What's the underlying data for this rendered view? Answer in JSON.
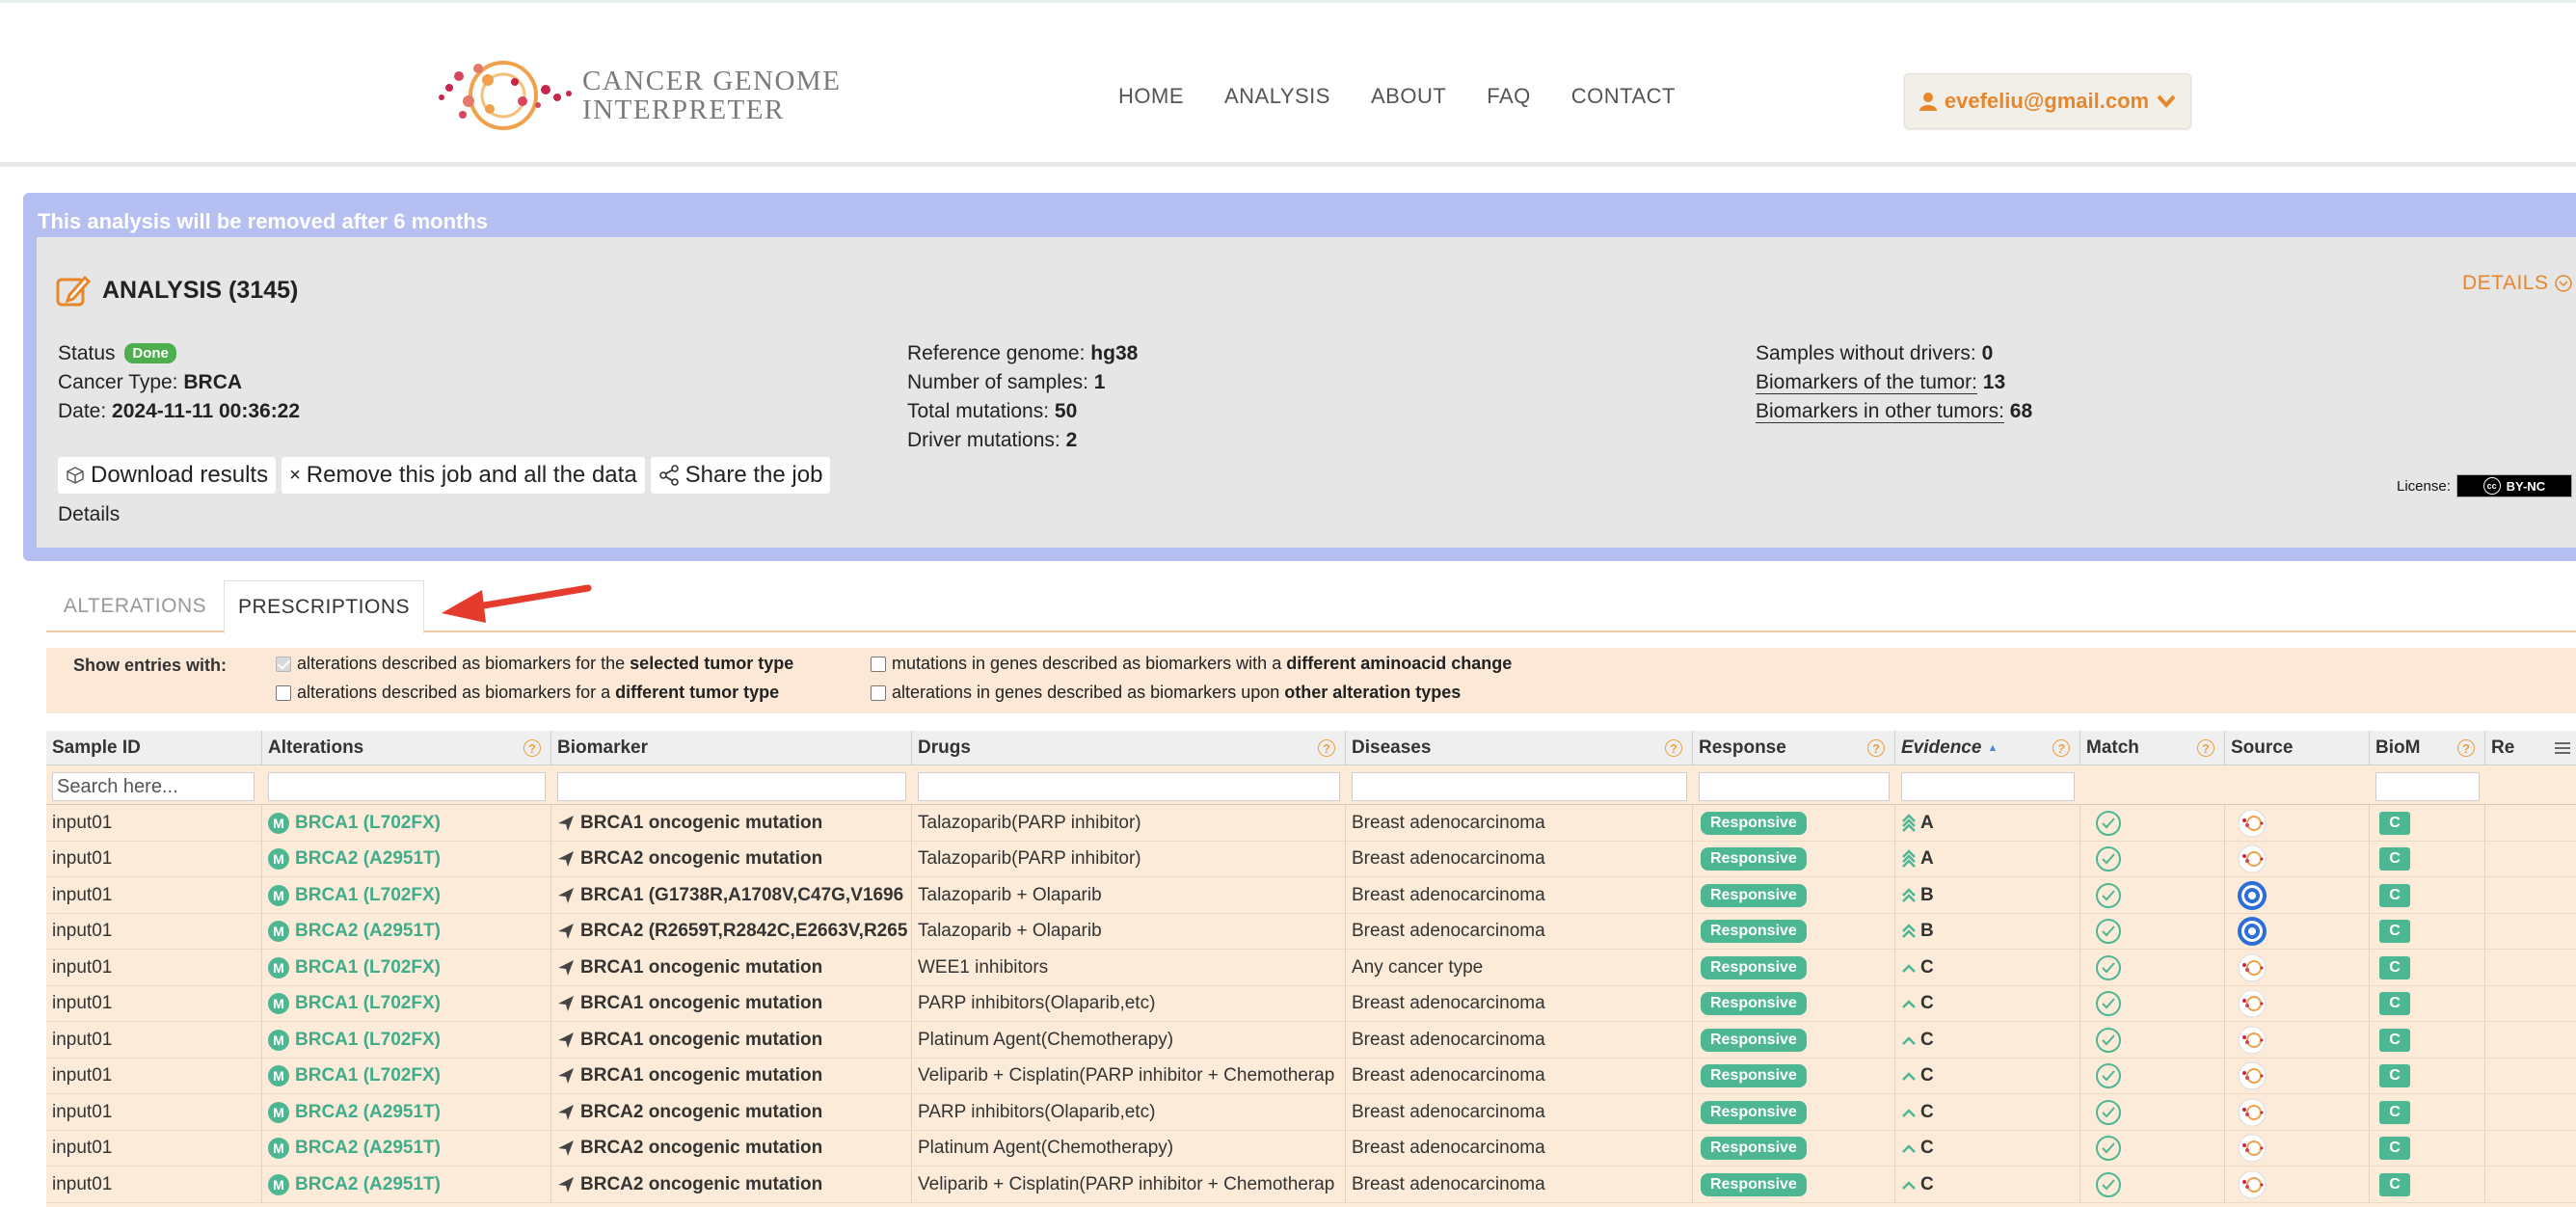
{
  "nav": {
    "logo_line1": "CANCER GENOME",
    "logo_line2": "INTERPRETER",
    "links": [
      "HOME",
      "ANALYSIS",
      "ABOUT",
      "FAQ",
      "CONTACT"
    ],
    "user_email": "evefeliu@gmail.com"
  },
  "colors": {
    "accent": "#e8862b",
    "green": "#4db794",
    "panel_border": "#b6bff1",
    "row_bg": "#fcebd8"
  },
  "analysis": {
    "removal_notice": "This analysis will be removed after 6 months",
    "title": "ANALYSIS (3145)",
    "details_link": "DETAILS",
    "status_label": "Status",
    "status_value": "Done",
    "cancer_type_label": "Cancer Type:",
    "cancer_type_value": "BRCA",
    "date_label": "Date:",
    "date_value": "2024-11-11 00:36:22",
    "ref_genome_label": "Reference genome:",
    "ref_genome_value": "hg38",
    "num_samples_label": "Number of samples:",
    "num_samples_value": "1",
    "total_mutations_label": "Total mutations:",
    "total_mutations_value": "50",
    "driver_mutations_label": "Driver mutations:",
    "driver_mutations_value": "2",
    "samples_without_drivers_label": "Samples without drivers:",
    "samples_without_drivers_value": "0",
    "biomarkers_tumor_label": "Biomarkers of the tumor:",
    "biomarkers_tumor_value": "13",
    "biomarkers_other_label": "Biomarkers in other tumors:",
    "biomarkers_other_value": "68",
    "download_label": "Download results",
    "remove_label": "Remove this job and all the data",
    "share_label": "Share the job",
    "details_text": "Details",
    "license_label": "License:",
    "license_badge": "BY-NC"
  },
  "tabs": [
    "ALTERATIONS",
    "PRESCRIPTIONS"
  ],
  "filters": {
    "label": "Show entries with:",
    "f1_text": "alterations described as biomarkers for the ",
    "f1_bold": "selected tumor type",
    "f2_text": "alterations described as biomarkers for a ",
    "f2_bold": "different tumor type",
    "f3_text": "mutations in genes described as biomarkers with a ",
    "f3_bold": "different aminoacid change",
    "f4_text": "alterations in genes described as biomarkers upon ",
    "f4_bold": "other alteration types"
  },
  "table": {
    "columns": [
      "Sample ID",
      "Alterations",
      "Biomarker",
      "Drugs",
      "Diseases",
      "Response",
      "Evidence",
      "Match",
      "Source",
      "BioM",
      "Re"
    ],
    "search_placeholder": "Search here...",
    "rows": [
      {
        "sample": "input01",
        "alteration": "BRCA1 (L702FX)",
        "biomarker": "BRCA1 oncogenic mutation",
        "drugs": "Talazoparib(PARP inhibitor)",
        "disease": "Breast adenocarcinoma",
        "response": "Responsive",
        "evidence": "A",
        "source_icon": "civic-icon",
        "biom": "C"
      },
      {
        "sample": "input01",
        "alteration": "BRCA2 (A2951T)",
        "biomarker": "BRCA2 oncogenic mutation",
        "drugs": "Talazoparib(PARP inhibitor)",
        "disease": "Breast adenocarcinoma",
        "response": "Responsive",
        "evidence": "A",
        "source_icon": "civic-icon",
        "biom": "C"
      },
      {
        "sample": "input01",
        "alteration": "BRCA1 (L702FX)",
        "biomarker": "BRCA1 (G1738R,A1708V,C47G,V1696",
        "drugs": "Talazoparib + Olaparib",
        "disease": "Breast adenocarcinoma",
        "response": "Responsive",
        "evidence": "B",
        "source_icon": "target-icon",
        "biom": "C"
      },
      {
        "sample": "input01",
        "alteration": "BRCA2 (A2951T)",
        "biomarker": "BRCA2 (R2659T,R2842C,E2663V,R265",
        "drugs": "Talazoparib + Olaparib",
        "disease": "Breast adenocarcinoma",
        "response": "Responsive",
        "evidence": "B",
        "source_icon": "target-icon",
        "biom": "C"
      },
      {
        "sample": "input01",
        "alteration": "BRCA1 (L702FX)",
        "biomarker": "BRCA1 oncogenic mutation",
        "drugs": "WEE1 inhibitors",
        "disease": "Any cancer type",
        "response": "Responsive",
        "evidence": "C",
        "source_icon": "civic-icon",
        "biom": "C"
      },
      {
        "sample": "input01",
        "alteration": "BRCA1 (L702FX)",
        "biomarker": "BRCA1 oncogenic mutation",
        "drugs": "PARP inhibitors(Olaparib,etc)",
        "disease": "Breast adenocarcinoma",
        "response": "Responsive",
        "evidence": "C",
        "source_icon": "civic-icon",
        "biom": "C"
      },
      {
        "sample": "input01",
        "alteration": "BRCA1 (L702FX)",
        "biomarker": "BRCA1 oncogenic mutation",
        "drugs": "Platinum Agent(Chemotherapy)",
        "disease": "Breast adenocarcinoma",
        "response": "Responsive",
        "evidence": "C",
        "source_icon": "civic-icon",
        "biom": "C"
      },
      {
        "sample": "input01",
        "alteration": "BRCA1 (L702FX)",
        "biomarker": "BRCA1 oncogenic mutation",
        "drugs": "Veliparib + Cisplatin(PARP inhibitor + Chemotherap",
        "disease": "Breast adenocarcinoma",
        "response": "Responsive",
        "evidence": "C",
        "source_icon": "civic-icon",
        "biom": "C"
      },
      {
        "sample": "input01",
        "alteration": "BRCA2 (A2951T)",
        "biomarker": "BRCA2 oncogenic mutation",
        "drugs": "PARP inhibitors(Olaparib,etc)",
        "disease": "Breast adenocarcinoma",
        "response": "Responsive",
        "evidence": "C",
        "source_icon": "civic-icon",
        "biom": "C"
      },
      {
        "sample": "input01",
        "alteration": "BRCA2 (A2951T)",
        "biomarker": "BRCA2 oncogenic mutation",
        "drugs": "Platinum Agent(Chemotherapy)",
        "disease": "Breast adenocarcinoma",
        "response": "Responsive",
        "evidence": "C",
        "source_icon": "civic-icon",
        "biom": "C"
      },
      {
        "sample": "input01",
        "alteration": "BRCA2 (A2951T)",
        "biomarker": "BRCA2 oncogenic mutation",
        "drugs": "Veliparib + Cisplatin(PARP inhibitor + Chemotherap",
        "disease": "Breast adenocarcinoma",
        "response": "Responsive",
        "evidence": "C",
        "source_icon": "civic-icon",
        "biom": "C"
      }
    ]
  }
}
